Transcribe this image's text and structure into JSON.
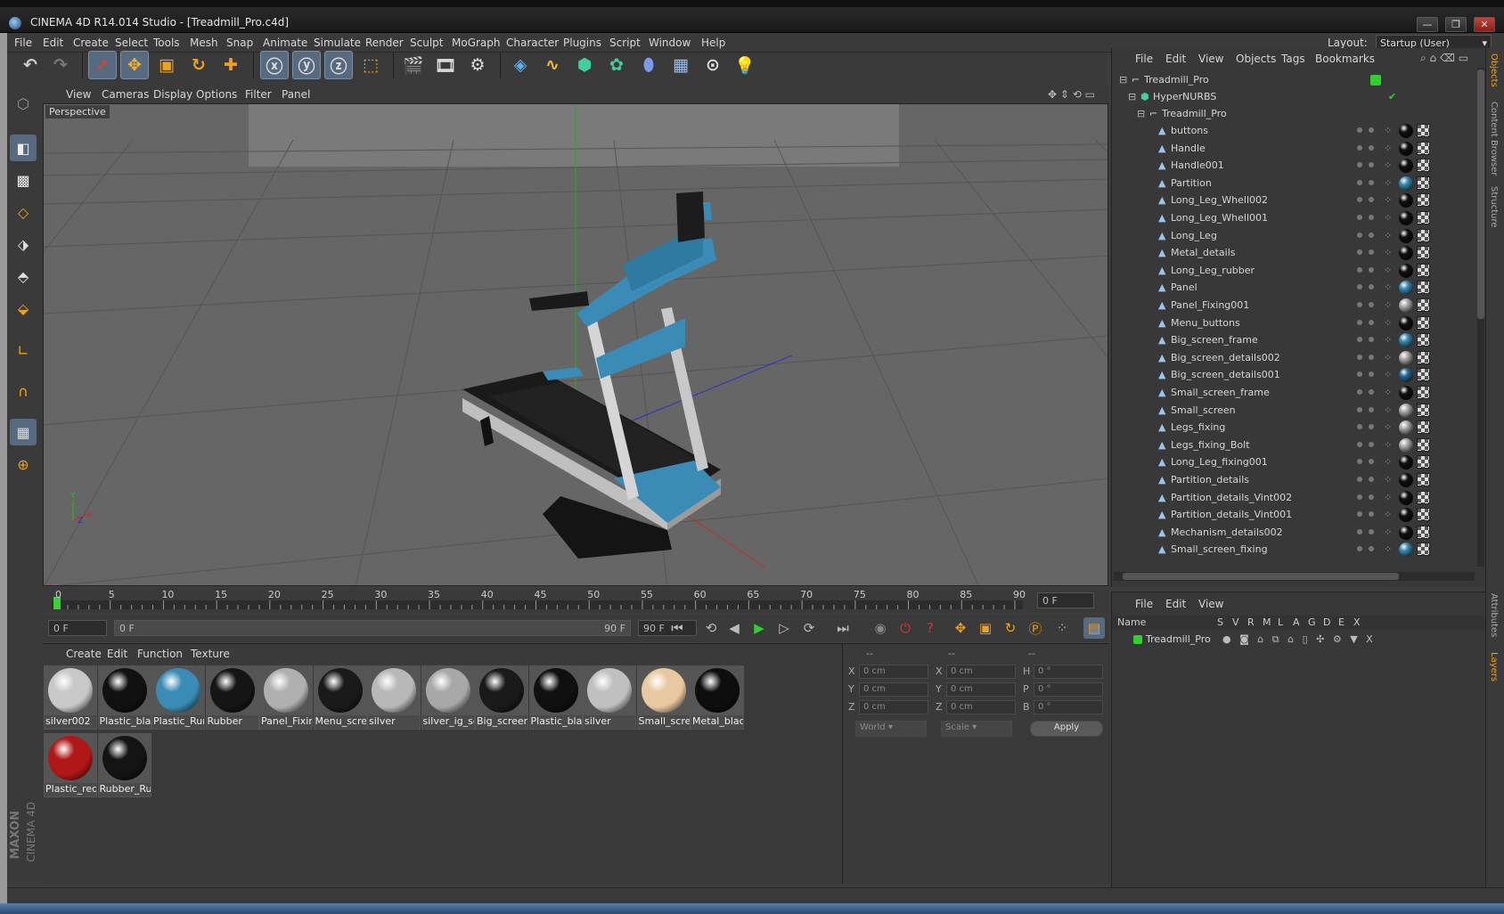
{
  "window": {
    "title": "CINEMA 4D R14.014 Studio - [Treadmill_Pro.c4d]",
    "min": "—",
    "max": "❐",
    "close": "✕"
  },
  "menu": [
    "File",
    "Edit",
    "Create",
    "Select",
    "Tools",
    "Mesh",
    "Snap",
    "Animate",
    "Simulate",
    "Render",
    "Sculpt",
    "MoGraph",
    "Character",
    "Plugins",
    "Script",
    "Window",
    "Help"
  ],
  "layout": {
    "label": "Layout:",
    "value": "Startup (User)"
  },
  "viewport": {
    "menu": [
      "View",
      "Cameras",
      "Display",
      "Options",
      "Filter",
      "Panel"
    ],
    "label": "Perspective",
    "axis": {
      "y": "Y",
      "x": "X",
      "z": "Z"
    }
  },
  "timeline": {
    "ticks": [
      "0",
      "5",
      "10",
      "15",
      "20",
      "25",
      "30",
      "35",
      "40",
      "45",
      "50",
      "55",
      "60",
      "65",
      "70",
      "75",
      "80",
      "85",
      "90"
    ],
    "frame_field": "0 F"
  },
  "transport": {
    "start": "0 F",
    "slider_start": "0 F",
    "slider_end": "90 F",
    "end": "90 F"
  },
  "materials": {
    "menu": [
      "Create",
      "Edit",
      "Function",
      "Texture"
    ],
    "items": [
      {
        "label": "silver002",
        "color": "#c8c8c8"
      },
      {
        "label": "Plastic_blac",
        "color": "#111111"
      },
      {
        "label": "Plastic_Rur",
        "color": "#3a8bb5"
      },
      {
        "label": "Rubber",
        "color": "#151515"
      },
      {
        "label": "Panel_Fixin",
        "color": "#b0b0b0"
      },
      {
        "label": "Menu_scre",
        "color": "#1a1a1a"
      },
      {
        "label": "silver",
        "color": "#b8b8b8"
      },
      {
        "label": "silver_ig_sc",
        "color": "#a8a8a8"
      },
      {
        "label": "Big_screen",
        "color": "#1a1a1a"
      },
      {
        "label": "Plastic_blac",
        "color": "#101010"
      },
      {
        "label": "silver",
        "color": "#c0c0c0"
      },
      {
        "label": "Small_scree",
        "color": "#e8c8a0"
      },
      {
        "label": "Metal_blac",
        "color": "#0e0e0e"
      },
      {
        "label": "Plastic_red",
        "color": "#b01818"
      },
      {
        "label": "Rubber_Ru",
        "color": "#141414"
      }
    ]
  },
  "coords": {
    "headers": [
      "--",
      "--",
      "--"
    ],
    "rows": [
      {
        "a": "X",
        "av": "0 cm",
        "b": "X",
        "bv": "0 cm",
        "c": "H",
        "cv": "0 °"
      },
      {
        "a": "Y",
        "av": "0 cm",
        "b": "Y",
        "bv": "0 cm",
        "c": "P",
        "cv": "0 °"
      },
      {
        "a": "Z",
        "av": "0 cm",
        "b": "Z",
        "bv": "0 cm",
        "c": "B",
        "cv": "0 °"
      }
    ],
    "world": "World",
    "scale": "Scale",
    "apply": "Apply"
  },
  "objects": {
    "menu": [
      "File",
      "Edit",
      "View",
      "Objects",
      "Tags",
      "Bookmarks"
    ],
    "root": "Treadmill_Pro",
    "hypernurbs": "HyperNURBS",
    "group": "Treadmill_Pro",
    "children": [
      "buttons",
      "Handle",
      "Handle001",
      "Partition",
      "Long_Leg_Whell002",
      "Long_Leg_Whell001",
      "Long_Leg",
      "Metal_details",
      "Long_Leg_rubber",
      "Panel",
      "Panel_Fixing001",
      "Menu_buttons",
      "Big_screen_frame",
      "Big_screen_details002",
      "Big_screen_details001",
      "Small_screen_frame",
      "Small_screen",
      "Legs_fixing",
      "Legs_fixing_Bolt",
      "Long_Leg_fixing001",
      "Partition_details",
      "Partition_details_Vint002",
      "Partition_details_Vint001",
      "Mechanism_details002",
      "Small_screen_fixing"
    ],
    "tag_colors": [
      "#111",
      "#111",
      "#111",
      "#3a8bb5",
      "#111",
      "#111",
      "#111",
      "#111",
      "#111",
      "#3a8bb5",
      "#aaa",
      "#111",
      "#3a8bb5",
      "#aaa",
      "#2a6a90",
      "#111",
      "#aaa",
      "#aaa",
      "#aaa",
      "#111",
      "#111",
      "#111",
      "#111",
      "#111",
      "#3a8bb5"
    ]
  },
  "layers": {
    "menu": [
      "File",
      "Edit",
      "View"
    ],
    "cols": [
      "Name",
      "S",
      "V",
      "R",
      "M",
      "L",
      "A",
      "G",
      "D",
      "E",
      "X"
    ],
    "row": "Treadmill_Pro"
  },
  "sidetabs": [
    "Objects",
    "Content Browser",
    "Structure",
    "Attributes",
    "Layers"
  ],
  "logo": {
    "maxon": "MAXON",
    "c4d": "CINEMA 4D"
  }
}
